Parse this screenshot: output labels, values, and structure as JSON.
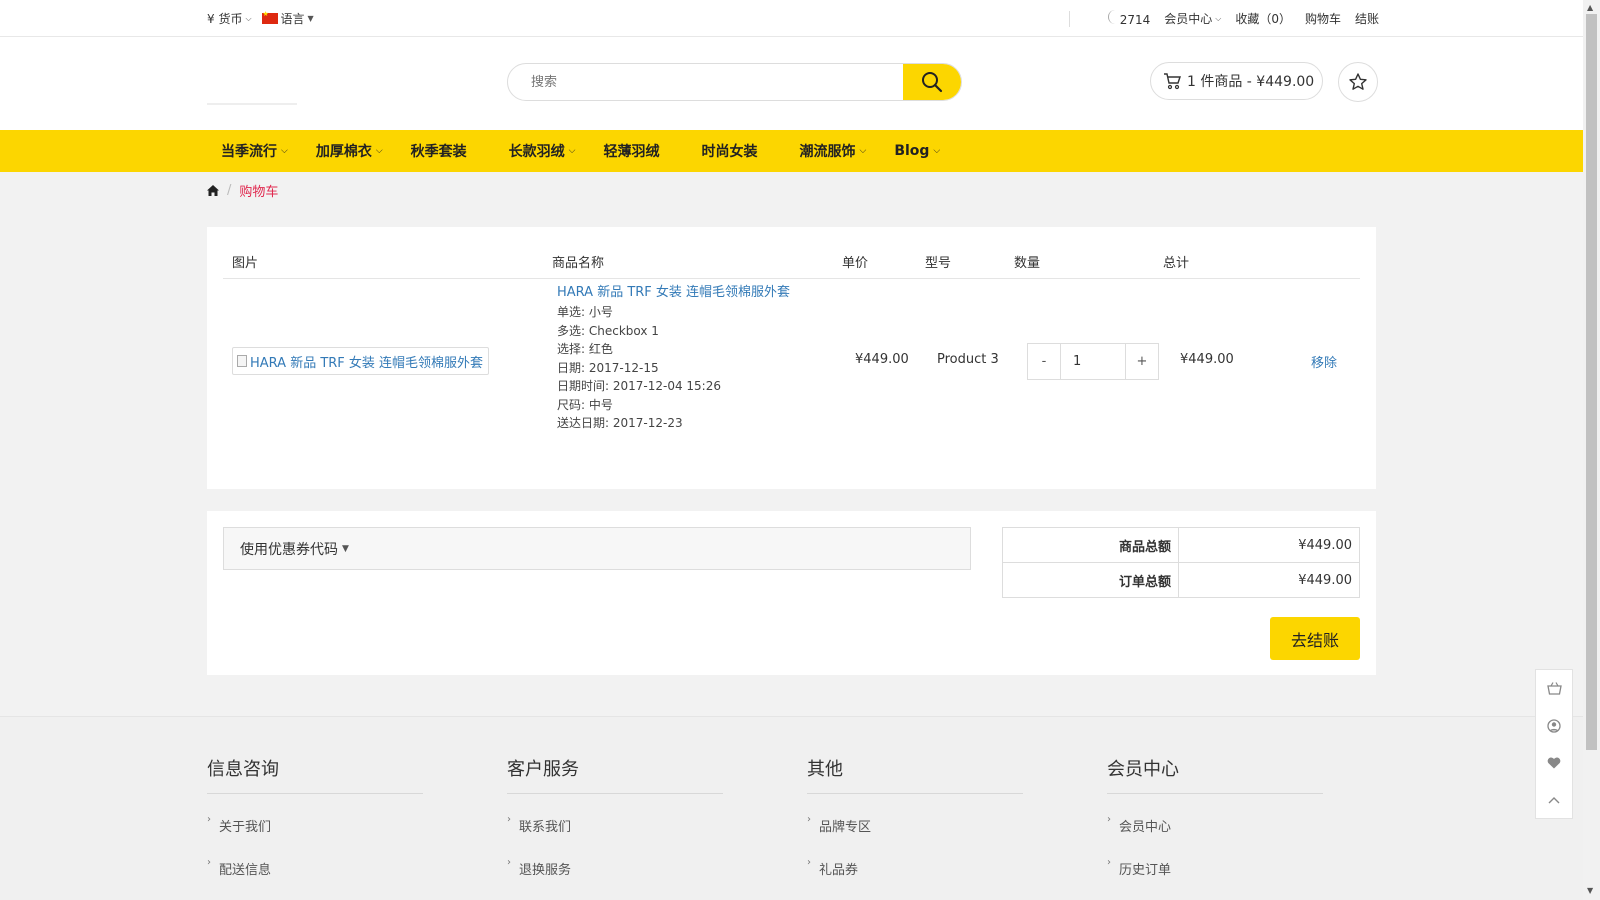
{
  "topbar": {
    "currency_label": "¥ 货币",
    "language_label": "语言",
    "phone": "2714",
    "account": "会员中心",
    "wishlist": "收藏（0）",
    "cart": "购物车",
    "checkout": "结账"
  },
  "header": {
    "search_placeholder": "搜索",
    "cart_summary": "1 件商品 - ¥449.00"
  },
  "nav": {
    "items": [
      "当季流行",
      "加厚棉衣",
      "秋季套装",
      "长款羽绒",
      "轻薄羽绒",
      "时尚女装",
      "潮流服饰",
      "Blog"
    ]
  },
  "breadcrumb": {
    "current": "购物车"
  },
  "cart_table": {
    "headers": {
      "image": "图片",
      "name": "商品名称",
      "unit_price": "单价",
      "model": "型号",
      "quantity": "数量",
      "total": "总计"
    },
    "row": {
      "image_alt": "HARA 新品 TRF 女装 连帽毛领棉服外套",
      "name": "HARA 新品 TRF 女装 连帽毛领棉服外套",
      "options": [
        "单选: 小号",
        "多选: Checkbox 1",
        "选择: 红色",
        "日期: 2017-12-15",
        "日期时间: 2017-12-04 15:26",
        "尺码: 中号",
        "送达日期: 2017-12-23"
      ],
      "unit_price": "¥449.00",
      "model": "Product 3",
      "qty_minus": "-",
      "quantity": "1",
      "qty_plus": "+",
      "total": "¥449.00",
      "remove": "移除"
    }
  },
  "coupon": {
    "label": "使用优惠券代码"
  },
  "totals": {
    "subtotal_label": "商品总额",
    "subtotal": "¥449.00",
    "total_label": "订单总额",
    "total": "¥449.00",
    "checkout_button": "去结账"
  },
  "footer": {
    "columns": [
      {
        "title": "信息咨询",
        "links": [
          "关于我们",
          "配送信息"
        ]
      },
      {
        "title": "客户服务",
        "links": [
          "联系我们",
          "退换服务"
        ]
      },
      {
        "title": "其他",
        "links": [
          "品牌专区",
          "礼品券"
        ]
      },
      {
        "title": "会员中心",
        "links": [
          "会员中心",
          "历史订单"
        ]
      }
    ]
  },
  "colors": {
    "accent": "#fcd600",
    "link": "#337ab7",
    "breadcrumb_active": "#e0284e"
  }
}
